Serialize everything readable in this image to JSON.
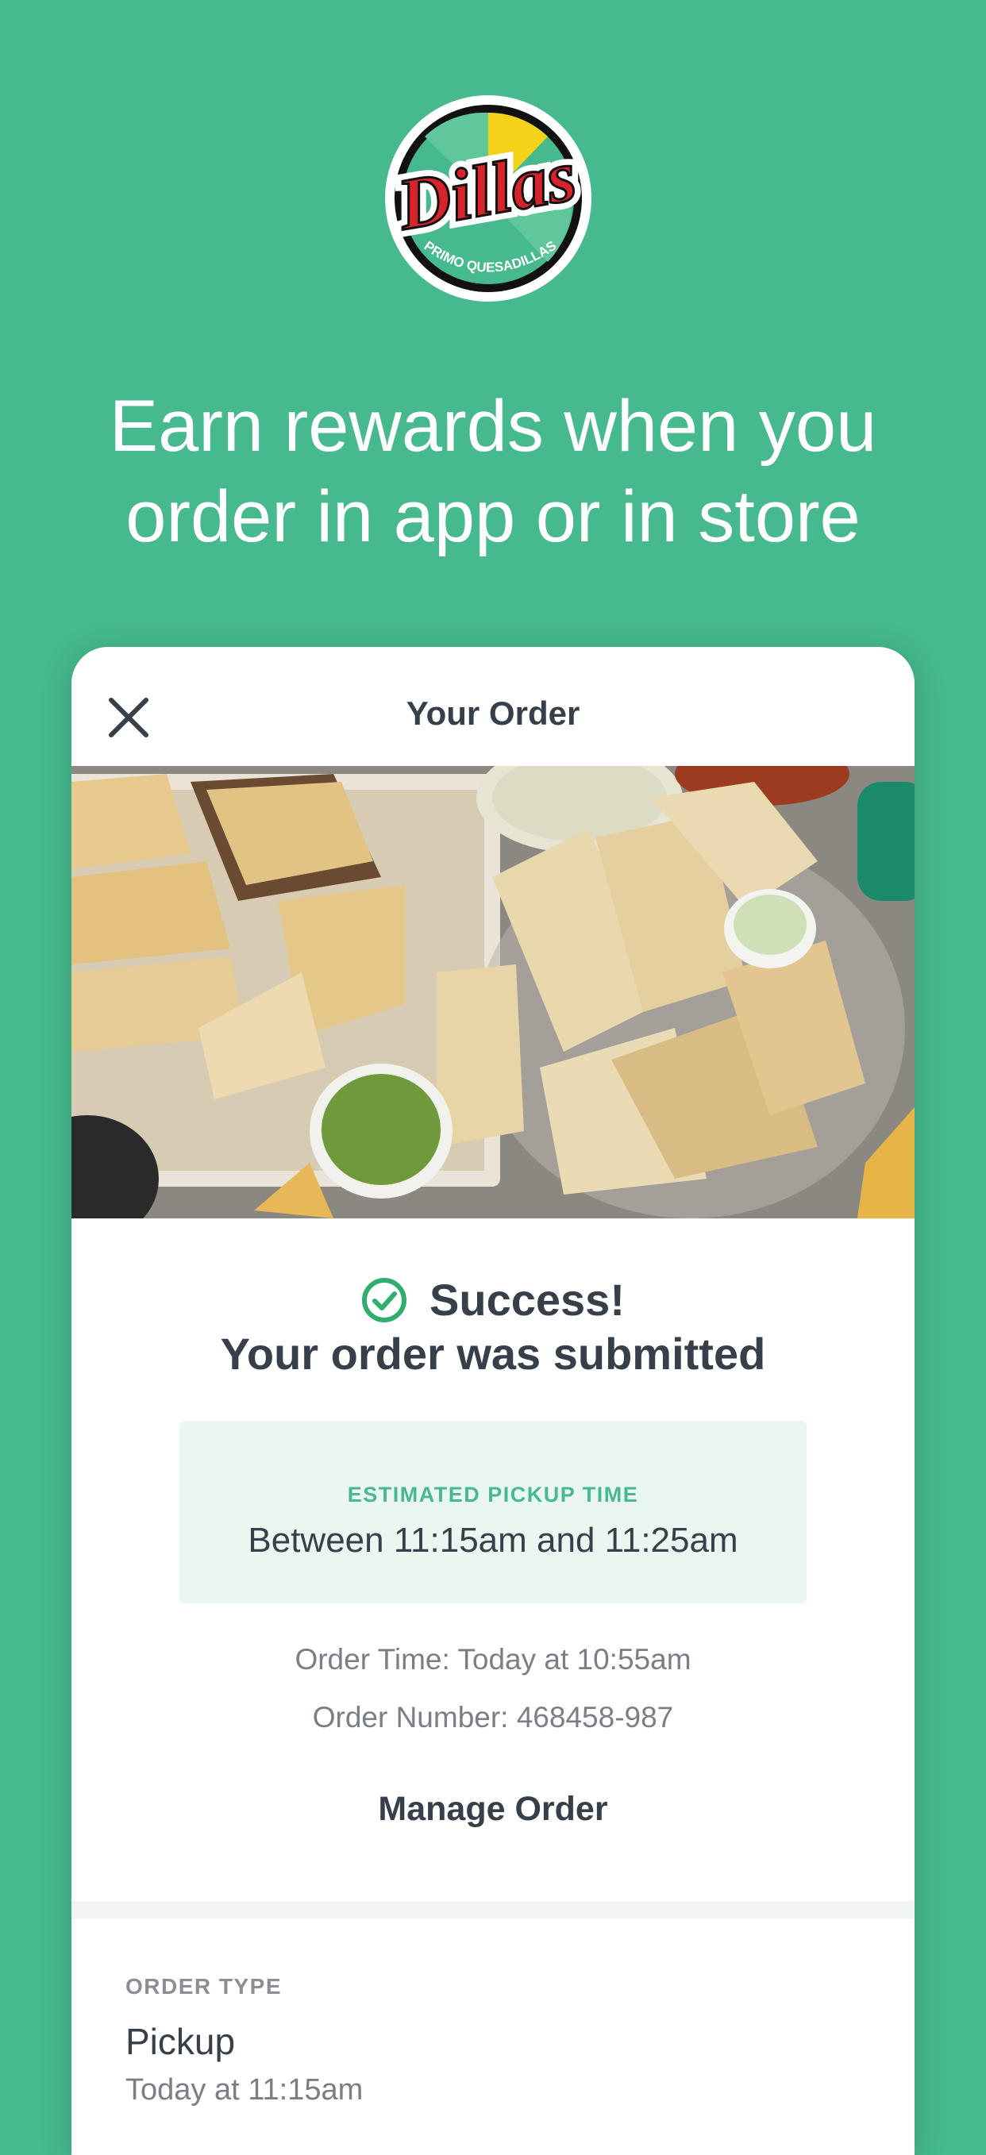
{
  "brand": {
    "logo_text": "Dillas",
    "logo_subtext": "PRIMO QUESADILLAS",
    "background_color": "#46b98e"
  },
  "headline": {
    "line1": "Earn rewards when you",
    "line2": "order in app or in store"
  },
  "order_card": {
    "title": "Your Order",
    "close_icon": "close-icon",
    "hero_image": "quesadillas-platter-photo",
    "success_title": "Success!",
    "success_subtitle": "Your order was submitted",
    "pickup": {
      "label": "ESTIMATED PICKUP TIME",
      "value": "Between 11:15am and 11:25am"
    },
    "order_time": "Order Time: Today at 10:55am",
    "order_number": "Order Number: 468458-987",
    "manage_label": "Manage Order",
    "order_type": {
      "label": "ORDER TYPE",
      "value": "Pickup",
      "time": "Today at 11:15am"
    }
  }
}
